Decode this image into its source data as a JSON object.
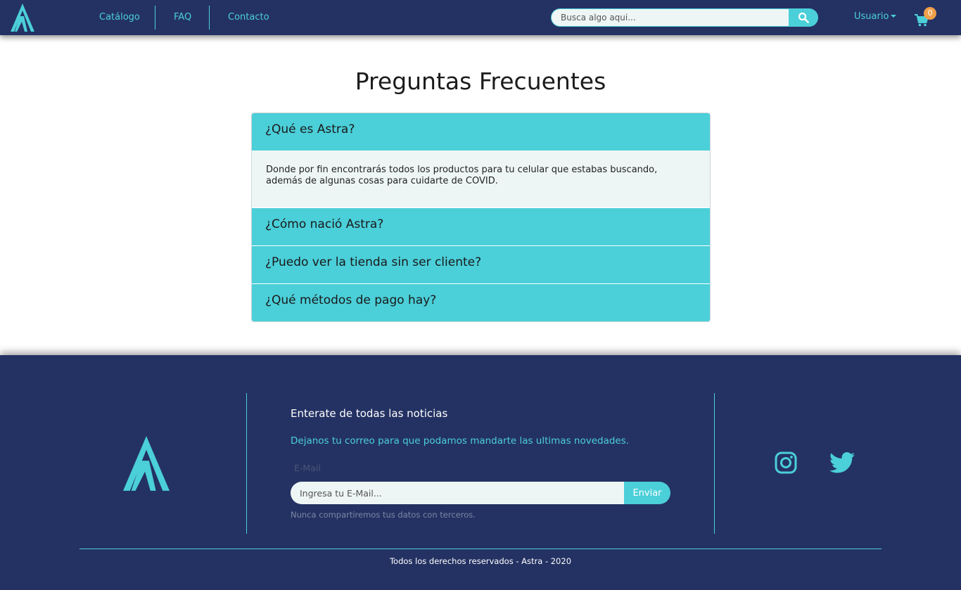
{
  "navbar": {
    "links": [
      {
        "label": "Catálogo"
      },
      {
        "label": "FAQ"
      },
      {
        "label": "Contacto"
      }
    ],
    "search_placeholder": "Busca algo aqui...",
    "user_label": "Usuario",
    "cart_count": "0"
  },
  "main": {
    "title": "Preguntas Frecuentes",
    "faq": [
      {
        "question": "¿Qué es Astra?",
        "answer": "Donde por fin encontrarás todos los productos para tu celular que estabas buscando, además de algunas cosas para cuidarte de COVID.",
        "expanded": true
      },
      {
        "question": "¿Cómo nació Astra?",
        "expanded": false
      },
      {
        "question": "¿Puedo ver la tienda sin ser cliente?",
        "expanded": false
      },
      {
        "question": "¿Qué métodos de pago hay?",
        "expanded": false
      }
    ]
  },
  "footer": {
    "newsletter_title": "Enterate de todas las noticias",
    "newsletter_subtitle": "Dejanos tu correo para que podamos mandarte las ultimas novedades.",
    "email_label": "E-Mail",
    "email_placeholder": "Ingresa tu E-Mail...",
    "send_label": "Enviar",
    "email_help": "Nunca compartiremos tus datos con terceros.",
    "social": [
      "instagram-icon",
      "twitter-icon"
    ],
    "copyright": "Todos los derechos reservados - Astra - 2020"
  },
  "colors": {
    "navy": "#243263",
    "accent": "#4bcfd9",
    "light_bg": "#eef6f5",
    "badge": "#f0a04b"
  }
}
